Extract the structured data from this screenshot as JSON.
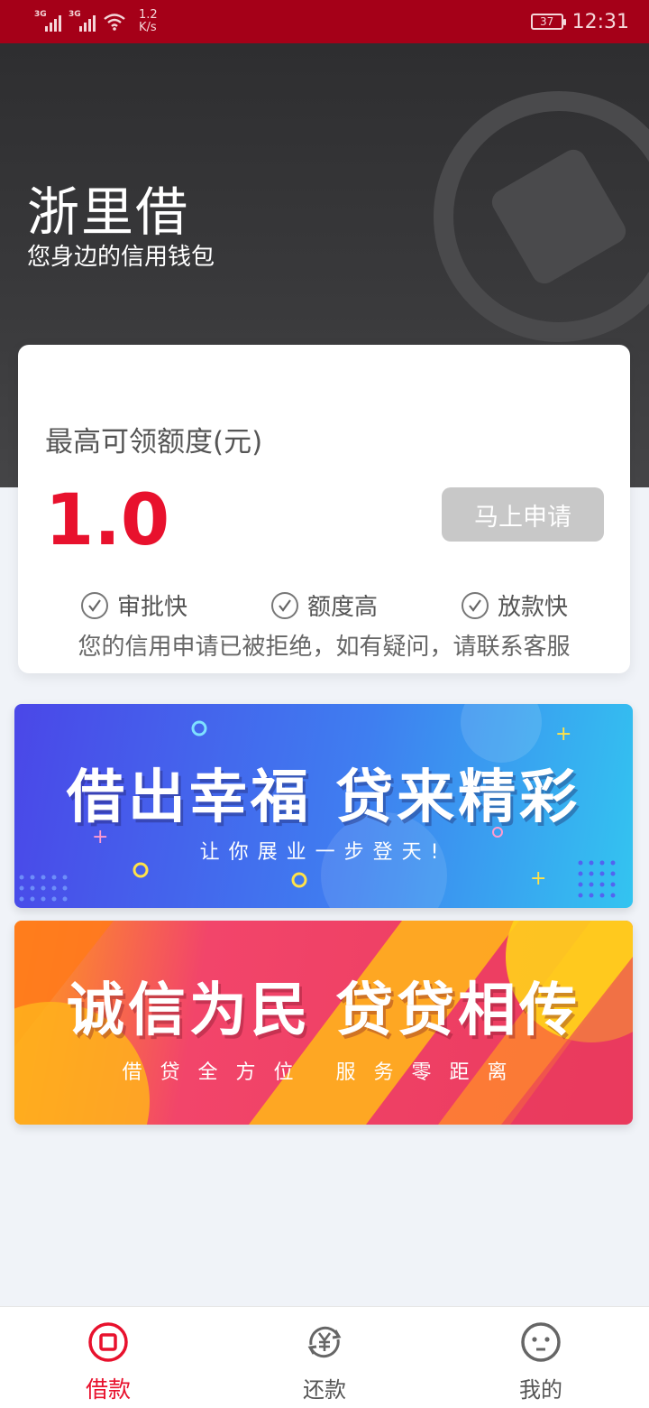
{
  "status_bar": {
    "net1": "3G",
    "net2": "3G",
    "speed_value": "1.2",
    "speed_unit": "K/s",
    "battery": "37",
    "time": "12:31"
  },
  "header": {
    "title": "浙里借",
    "subtitle": "您身边的信用钱包"
  },
  "credit_card": {
    "limit_label": "最高可领额度(元)",
    "limit_amount": "1.0",
    "apply_button": "马上申请",
    "features": [
      "审批快",
      "额度高",
      "放款快"
    ],
    "notice": "您的信用申请已被拒绝，如有疑问，请联系客服"
  },
  "banners": [
    {
      "title": "借出幸福 贷来精彩",
      "subtitle": "让你展业一步登天!"
    },
    {
      "title": "诚信为民 贷贷相传",
      "subtitle": "借贷全方位  服务零距离"
    }
  ],
  "bottom_nav": {
    "items": [
      {
        "label": "借款",
        "icon": "loan-icon",
        "active": true
      },
      {
        "label": "还款",
        "icon": "repay-icon",
        "active": false
      },
      {
        "label": "我的",
        "icon": "profile-icon",
        "active": false
      }
    ]
  },
  "colors": {
    "status_bar": "#a50018",
    "accent_red": "#e8112d",
    "header_dark": "#333335",
    "button_disabled": "#c8c8c8"
  }
}
